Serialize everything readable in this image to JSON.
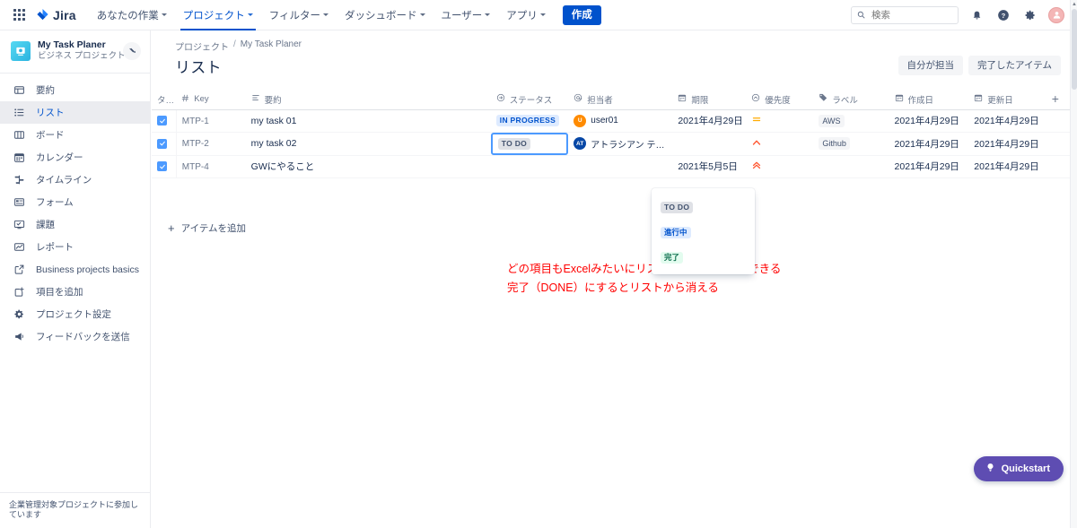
{
  "topnav": {
    "app_switcher_icon": "grid-apps-icon",
    "brand": "Jira",
    "items": [
      {
        "label": "あなたの作業",
        "has_caret": true,
        "active": false
      },
      {
        "label": "プロジェクト",
        "has_caret": true,
        "active": true
      },
      {
        "label": "フィルター",
        "has_caret": true,
        "active": false
      },
      {
        "label": "ダッシュボード",
        "has_caret": true,
        "active": false
      },
      {
        "label": "ユーザー",
        "has_caret": true,
        "active": false
      },
      {
        "label": "アプリ",
        "has_caret": true,
        "active": false
      }
    ],
    "create_label": "作成",
    "search_placeholder": "検索",
    "search_value": "",
    "icons": [
      "search-icon",
      "notifications-icon",
      "help-icon",
      "settings-icon",
      "profile-avatar"
    ]
  },
  "sidebar": {
    "project": {
      "name": "My Task Planer",
      "type": "ビジネス プロジェクト",
      "avatar_color": "#2BB3E0",
      "edit_icon": "paint-bucket-icon"
    },
    "items": [
      {
        "label": "要約",
        "icon": "summary-icon",
        "active": false
      },
      {
        "label": "リスト",
        "icon": "list-icon",
        "active": true
      },
      {
        "label": "ボード",
        "icon": "board-icon",
        "active": false
      },
      {
        "label": "カレンダー",
        "icon": "calendar-icon",
        "active": false
      },
      {
        "label": "タイムライン",
        "icon": "timeline-icon",
        "active": false
      },
      {
        "label": "フォーム",
        "icon": "form-icon",
        "active": false
      },
      {
        "label": "課題",
        "icon": "issues-icon",
        "active": false
      },
      {
        "label": "レポート",
        "icon": "reports-icon",
        "active": false
      },
      {
        "label": "Business projects basics",
        "icon": "external-link-icon",
        "active": false
      },
      {
        "label": "項目を追加",
        "icon": "add-shortcut-icon",
        "active": false
      },
      {
        "label": "プロジェクト設定",
        "icon": "gear-icon",
        "active": false
      },
      {
        "label": "フィードバックを送信",
        "icon": "megaphone-icon",
        "active": false
      }
    ],
    "footer_note": "企業管理対象プロジェクトに参加しています"
  },
  "breadcrumb": {
    "project_label": "プロジェクト",
    "separator": "/",
    "current": "My Task Planer"
  },
  "page_title": "リスト",
  "header_actions": [
    {
      "label": "自分が担当"
    },
    {
      "label": "完了したアイテム"
    }
  ],
  "table": {
    "columns": [
      {
        "key": "check",
        "label": "",
        "icon": ""
      },
      {
        "key": "type",
        "label": "タ…",
        "icon": ""
      },
      {
        "key": "issue_key",
        "label": "Key",
        "icon": "hash-icon"
      },
      {
        "key": "summary",
        "label": "要約",
        "icon": "text-lines-icon"
      },
      {
        "key": "status",
        "label": "ステータス",
        "icon": "status-arrow-icon"
      },
      {
        "key": "assignee",
        "label": "担当者",
        "icon": "at-icon"
      },
      {
        "key": "due",
        "label": "期限",
        "icon": "calendar-icon"
      },
      {
        "key": "priority",
        "label": "優先度",
        "icon": "priority-icon"
      },
      {
        "key": "labels",
        "label": "ラベル",
        "icon": "tag-icon"
      },
      {
        "key": "created",
        "label": "作成日",
        "icon": "calendar-icon"
      },
      {
        "key": "updated",
        "label": "更新日",
        "icon": "calendar-icon"
      }
    ],
    "add_column_icon": "plus-icon",
    "rows": [
      {
        "checked": true,
        "issue_key": "MTP-1",
        "summary": "my task 01",
        "status": {
          "label": "IN PROGRESS",
          "variant": "inprogress"
        },
        "assignee": {
          "name": "user01",
          "initials": "U",
          "color": "#FF8B00"
        },
        "due": "2021年4月29日",
        "priority": "medium",
        "labels": "AWS",
        "created": "2021年4月29日",
        "updated": "2021年4月29日"
      },
      {
        "checked": true,
        "issue_key": "MTP-2",
        "summary": "my task 02",
        "status": {
          "label": "TO DO",
          "variant": "todo",
          "editing": true
        },
        "assignee": {
          "name": "アトラシアン テス…",
          "initials": "AT",
          "color": "#0747A6"
        },
        "due": "",
        "priority": "high",
        "labels": "Github",
        "created": "2021年4月29日",
        "updated": "2021年4月29日"
      },
      {
        "checked": true,
        "issue_key": "MTP-4",
        "summary": "GWにやること",
        "status": {
          "label": "",
          "variant": "none"
        },
        "assignee": {
          "name": "",
          "initials": "",
          "color": ""
        },
        "due": "2021年5月5日",
        "priority": "highest",
        "labels": "",
        "created": "2021年4月29日",
        "updated": "2021年4月29日"
      }
    ]
  },
  "status_dropdown": {
    "open": true,
    "options": [
      {
        "label": "TO DO",
        "variant": "todo"
      },
      {
        "label": "進行中",
        "variant": "inprogress"
      },
      {
        "label": "完了",
        "variant": "done"
      }
    ]
  },
  "add_item": {
    "label": "アイテムを追加",
    "icon": "plus-icon"
  },
  "annotation": {
    "line1": "どの項目もExcelみたいにリスト表示を直接編集できる",
    "line2": "完了（DONE）にするとリストから消える",
    "color": "#FF0000"
  },
  "quickstart": {
    "label": "Quickstart",
    "icon": "lightbulb-icon",
    "color": "#5E4DB2"
  }
}
